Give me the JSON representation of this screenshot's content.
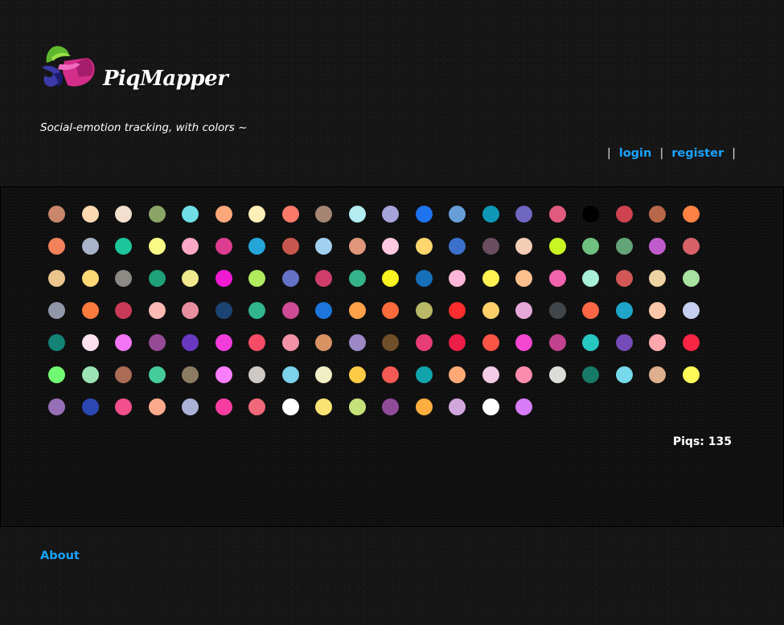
{
  "app": {
    "title": "PiqMapper",
    "tagline": "Social-emotion tracking, with colors ~"
  },
  "nav": {
    "separator": "|",
    "login_label": "login",
    "register_label": "register"
  },
  "piqs": {
    "count_label": "Piqs: 135",
    "colors": [
      "#c8876b",
      "#fcd9b0",
      "#f2dfcd",
      "#8aa468",
      "#6fdde3",
      "#fca779",
      "#feefb8",
      "#fb7968",
      "#a48672",
      "#b3ecf1",
      "#a7a3db",
      "#1e73ee",
      "#679ed8",
      "#0e98b5",
      "#6f66c1",
      "#e05b7f",
      "#000000",
      "#cf4350",
      "#b8674a",
      "#fb8144",
      "#f1825a",
      "#a8b3c9",
      "#1cc59a",
      "#fbfa86",
      "#fba8c6",
      "#dd3d90",
      "#25a6d8",
      "#c7574e",
      "#a2d0f0",
      "#e0967b",
      "#fdc8e0",
      "#fed66d",
      "#3a70cb",
      "#6a4d5e",
      "#f3cdb5",
      "#c8f623",
      "#6fc081",
      "#63a579",
      "#c05ccb",
      "#d86168",
      "#ecc48e",
      "#fed976",
      "#8d8a86",
      "#1ea178",
      "#f1e98e",
      "#f01ad3",
      "#b0ec5e",
      "#6572c5",
      "#cf3e6b",
      "#34b28a",
      "#fcf420",
      "#156fb9",
      "#fdb6d7",
      "#fdf252",
      "#fcbf8e",
      "#f064ad",
      "#a8f0d8",
      "#d25757",
      "#ecd3a1",
      "#a8e2a0",
      "#9196a9",
      "#fa7b3e",
      "#c83a55",
      "#fbbab3",
      "#e78f9f",
      "#1b4373",
      "#30b58c",
      "#cf4b95",
      "#1c76db",
      "#fea249",
      "#fb6a3a",
      "#b8b866",
      "#fc2d2e",
      "#fed069",
      "#e6a7d9",
      "#3f4548",
      "#fb6745",
      "#1ea5c9",
      "#fbc7a8",
      "#c5cff0",
      "#138376",
      "#fce0ee",
      "#f275f5",
      "#954a94",
      "#6a39c2",
      "#f23ddc",
      "#f64c68",
      "#f392a6",
      "#d89263",
      "#9c87c7",
      "#6f4e2a",
      "#e63d76",
      "#ec1f49",
      "#fc5446",
      "#f247ce",
      "#c0418c",
      "#27c7c2",
      "#744bb8",
      "#fba7ad",
      "#fa2444",
      "#72f973",
      "#9be3b5",
      "#ab6c55",
      "#46cc9b",
      "#8a7b62",
      "#fa7efc",
      "#cec9c5",
      "#7cd2ea",
      "#f0efc5",
      "#fecb47",
      "#f25a53",
      "#11a4ad",
      "#fdaa76",
      "#f2cbe6",
      "#f98cac",
      "#dcdcd8",
      "#177a66",
      "#76d9ec",
      "#deaf8c",
      "#fdfa59",
      "#966fb7",
      "#2b47b4",
      "#f2508c",
      "#fcaa8e",
      "#aab2d6",
      "#f73da1",
      "#f0687a",
      "#ffffff",
      "#fbe274",
      "#c5e17a",
      "#8f4b98",
      "#fdae3f",
      "#d2a7dd",
      "#ffffff",
      "#d77cf7"
    ]
  },
  "footer": {
    "about_label": "About"
  }
}
